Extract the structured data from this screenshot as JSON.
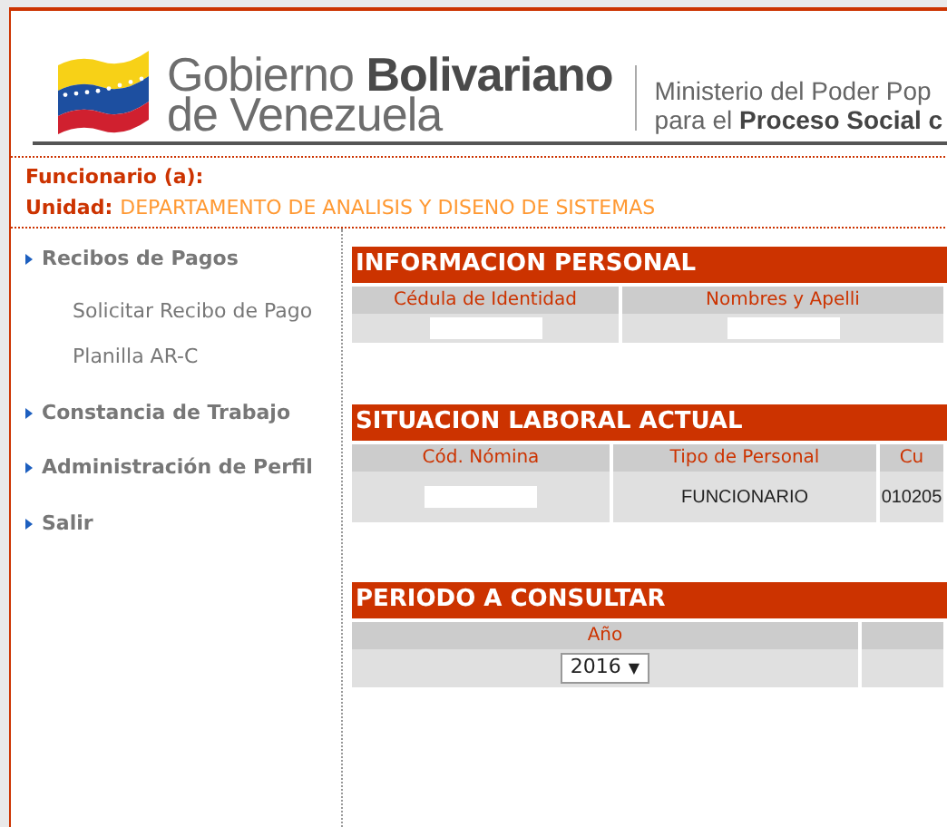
{
  "header": {
    "logo_line1_regular": "Gobierno",
    "logo_line1_bold": "Bolivariano",
    "logo_line2": "de Venezuela",
    "ministry_line1": "Ministerio del Poder Pop",
    "ministry_line2_regular": "para el",
    "ministry_line2_bold": "Proceso Social c"
  },
  "user": {
    "funcionario_label": "Funcionario (a):",
    "unidad_label": "Unidad:",
    "unidad_value": "DEPARTAMENTO DE ANALISIS Y DISENO DE SISTEMAS"
  },
  "sidebar": {
    "items": [
      {
        "label": "Recibos de Pagos",
        "children": [
          {
            "label": "Solicitar Recibo de Pago"
          },
          {
            "label": "Planilla AR-C"
          }
        ]
      },
      {
        "label": "Constancia de Trabajo"
      },
      {
        "label": "Administración de Perfil"
      },
      {
        "label": "Salir"
      }
    ]
  },
  "sections": [
    {
      "title": "INFORMACION PERSONAL",
      "columns": [
        "Cédula de Identidad",
        "Nombres y Apelli"
      ],
      "row": [
        {
          "kind": "blank"
        },
        {
          "kind": "blank"
        }
      ]
    },
    {
      "title": "SITUACION LABORAL ACTUAL",
      "columns": [
        "Cód. Nómina",
        "Tipo de Personal",
        "Cu"
      ],
      "row": [
        {
          "kind": "blank"
        },
        {
          "kind": "text",
          "text": "FUNCIONARIO"
        },
        {
          "kind": "text",
          "text": "010205"
        }
      ]
    },
    {
      "title": "PERIODO A CONSULTAR",
      "columns": [
        "Año",
        ""
      ],
      "row": [
        {
          "kind": "select",
          "value": "2016",
          "arrow": "▼"
        },
        {
          "kind": "empty"
        }
      ]
    }
  ]
}
